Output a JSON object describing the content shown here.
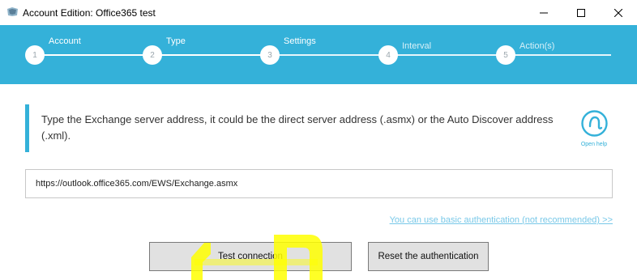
{
  "window": {
    "title": "Account Edition: Office365 test",
    "controls": [
      "minimize",
      "maximize",
      "close"
    ]
  },
  "wizard": {
    "steps": [
      {
        "number": "1",
        "label": "Account",
        "state": "done"
      },
      {
        "number": "2",
        "label": "Type",
        "state": "done"
      },
      {
        "number": "3",
        "label": "Settings",
        "state": "current"
      },
      {
        "number": "4",
        "label": "Interval",
        "state": "future"
      },
      {
        "number": "5",
        "label": "Action(s)",
        "state": "future"
      }
    ]
  },
  "info": {
    "text": "Type the Exchange server address, it could be the direct server address (.asmx) or the Auto Discover address (.xml).",
    "help_label": "Open help"
  },
  "server": {
    "value": "https://outlook.office365.com/EWS/Exchange.asmx"
  },
  "basic_auth_link": "You can use basic authentication (not recommended) >>",
  "buttons": {
    "test": "Test connection",
    "reset": "Reset the authentication"
  },
  "colors": {
    "accent": "#34b1d9",
    "link": "#78c8e8",
    "annotation": "#ffff00"
  }
}
